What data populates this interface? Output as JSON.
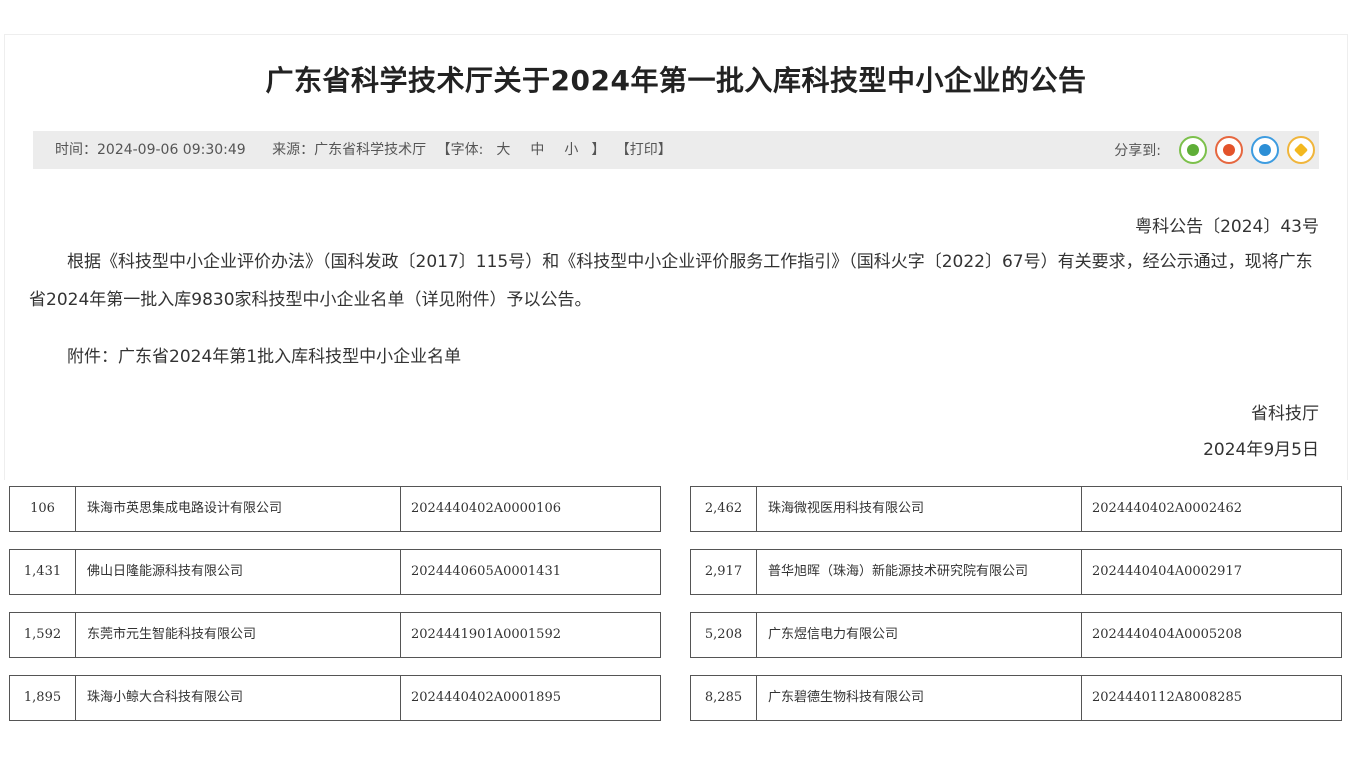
{
  "article": {
    "title": "广东省科学技术厅关于2024年第一批入库科技型中小企业的公告",
    "meta": {
      "time": "时间：2024-09-06 09:30:49",
      "source": "来源：广东省科学技术厅",
      "font_open": "【字体:",
      "font_large": "大",
      "font_medium": "中",
      "font_small": "小",
      "font_close": "】",
      "print": "【打印】",
      "share_label": "分享到:"
    },
    "share_icons": [
      "wechat-icon",
      "weibo-icon",
      "qq-icon",
      "favorite-icon"
    ],
    "doc_number": "粤科公告〔2024〕43号",
    "paragraph": "根据《科技型中小企业评价办法》（国科发政〔2017〕115号）和《科技型中小企业评价服务工作指引》（国科火字〔2022〕67号）有关要求，经公示通过，现将广东省2024年第一批入库9830家科技型中小企业名单（详见附件）予以公告。",
    "attachment": "附件：广东省2024年第1批入库科技型中小企业名单",
    "signature": "省科技厅",
    "sign_date": "2024年9月5日"
  },
  "tables": {
    "left": [
      {
        "num": "106",
        "name": "珠海市英思集成电路设计有限公司",
        "code": "2024440402A0000106"
      },
      {
        "num": "1,431",
        "name": "佛山日隆能源科技有限公司",
        "code": "2024440605A0001431"
      },
      {
        "num": "1,592",
        "name": "东莞市元生智能科技有限公司",
        "code": "2024441901A0001592"
      },
      {
        "num": "1,895",
        "name": "珠海小鲸大合科技有限公司",
        "code": "2024440402A0001895"
      }
    ],
    "right": [
      {
        "num": "2,462",
        "name": "珠海微视医用科技有限公司",
        "code": "2024440402A0002462"
      },
      {
        "num": "2,917",
        "name": "普华旭晖（珠海）新能源技术研究院有限公司",
        "code": "2024440404A0002917"
      },
      {
        "num": "5,208",
        "name": "广东煜信电力有限公司",
        "code": "2024440404A0005208"
      },
      {
        "num": "8,285",
        "name": "广东碧德生物科技有限公司",
        "code": "2024440112A8008285"
      }
    ]
  }
}
